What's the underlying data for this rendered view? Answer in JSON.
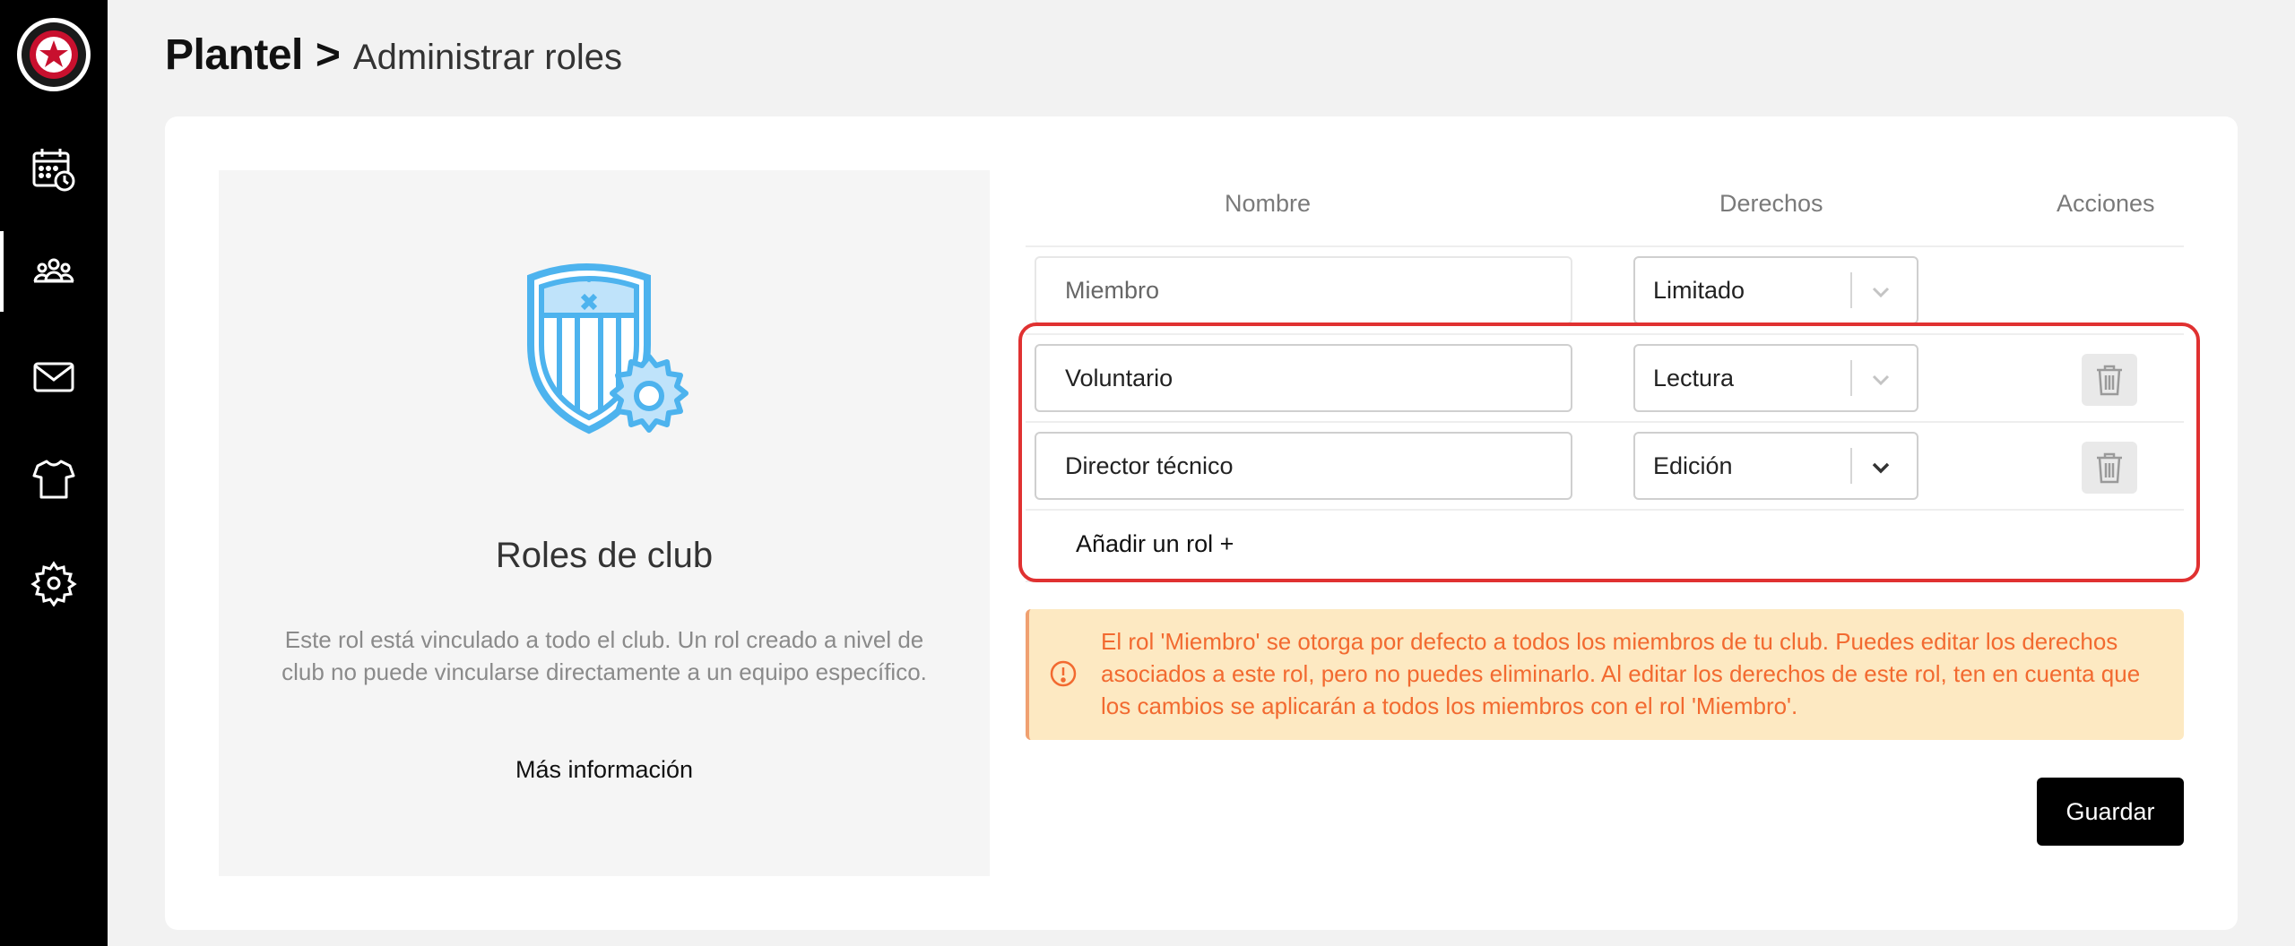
{
  "breadcrumb": {
    "root": "Plantel",
    "separator": ">",
    "current": "Administrar roles"
  },
  "sidebar": {
    "items": [
      {
        "icon": "calendar-clock-icon",
        "active": false
      },
      {
        "icon": "team-icon",
        "active": true
      },
      {
        "icon": "mail-icon",
        "active": false
      },
      {
        "icon": "jersey-icon",
        "active": false
      },
      {
        "icon": "gear-icon",
        "active": false
      }
    ]
  },
  "info_panel": {
    "title": "Roles de club",
    "description": "Este rol está vinculado a todo el club. Un rol creado a nivel de club no puede vincularse directamente a un equipo específico.",
    "link": "Más información"
  },
  "table": {
    "headers": {
      "name": "Nombre",
      "rights": "Derechos",
      "actions": "Acciones"
    },
    "rows": [
      {
        "name": "Miembro",
        "rights": "Limitado",
        "deletable": false
      },
      {
        "name": "Voluntario",
        "rights": "Lectura",
        "deletable": true
      },
      {
        "name": "Director técnico",
        "rights": "Edición",
        "deletable": true
      }
    ],
    "add_label": "Añadir un rol +"
  },
  "alert": {
    "text": "El rol 'Miembro' se otorga por defecto a todos los miembros de tu club. Puedes editar los derechos asociados a este rol, pero no puedes eliminarlo. Al editar los derechos de este rol, ten en cuenta que los cambios se aplicarán a todos los miembros con el rol 'Miembro'."
  },
  "actions": {
    "save_label": "Guardar"
  },
  "colors": {
    "accent_blue": "#4db3ee",
    "alert_bg": "#fde9c2",
    "alert_text": "#f26a30",
    "highlight": "#e03131"
  }
}
